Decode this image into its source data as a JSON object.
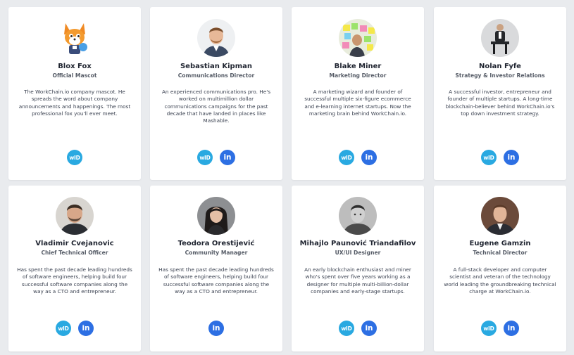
{
  "colors": {
    "page_bg": "#e9ebee",
    "card_bg": "#ffffff",
    "workchain_id": "#29a9e1",
    "linkedin": "#2d6fe3"
  },
  "social_labels": {
    "workchain_id": "wID",
    "linkedin": "in"
  },
  "team": [
    {
      "name": "Blox Fox",
      "role": "Official Mascot",
      "bio": "The WorkChain.io company mascot. He spreads the word about company announcements and happenings. The most professional fox you'll ever meet.",
      "avatar_icon": "fox-mascot-icon",
      "socials": [
        "workchain_id"
      ]
    },
    {
      "name": "Sebastian Kipman",
      "role": "Communications Director",
      "bio": "An experienced communications pro. He's worked on multimillion dollar communications campaigns for the past decade that have landed in places like Mashable.",
      "avatar_icon": "person-photo-icon",
      "socials": [
        "workchain_id",
        "linkedin"
      ]
    },
    {
      "name": "Blake Miner",
      "role": "Marketing Director",
      "bio": "A marketing wizard and founder of successful multiple six-figure ecommerce and e-learning internet startups. Now the marketing brain behind WorkChain.io.",
      "avatar_icon": "sticky-notes-icon",
      "socials": [
        "workchain_id",
        "linkedin"
      ]
    },
    {
      "name": "Nolan Fyfe",
      "role": "Strategy & Investor Relations",
      "bio": "A successful investor, entrepreneur and founder of multiple startups. A long-time blockchain-believer behind WorkChain.io's top down investment strategy.",
      "avatar_icon": "person-seated-icon",
      "socials": [
        "workchain_id",
        "linkedin"
      ]
    },
    {
      "name": "Vladimir Cvejanovic",
      "role": "Chief Technical Officer",
      "bio": "Has spent the past decade leading hundreds of software engineers, helping build four successful software companies along the way as a CTO and entrepreneur.",
      "avatar_icon": "person-photo-icon",
      "socials": [
        "workchain_id",
        "linkedin"
      ]
    },
    {
      "name": "Teodora Orestijević",
      "role": "Community Manager",
      "bio": "Has spent the past decade leading hundreds of software engineers, helping build four successful software companies along the way as a CTO and entrepreneur.",
      "avatar_icon": "person-photo-icon",
      "socials": [
        "linkedin"
      ]
    },
    {
      "name": "Mihajlo Paunović Triandafilov",
      "role": "UX/UI Designer",
      "bio": "An early blockchain enthusiast and miner who's spent over five years working as a designer for multiple multi-billion-dollar companies and early-stage startups.",
      "avatar_icon": "person-photo-icon",
      "socials": [
        "workchain_id",
        "linkedin"
      ]
    },
    {
      "name": "Eugene Gamzin",
      "role": "Technical Director",
      "bio": "A full-stack developer and computer scientist and veteran of the technology world leading the groundbreaking technical charge at WorkChain.io.",
      "avatar_icon": "person-photo-icon",
      "socials": [
        "workchain_id",
        "linkedin"
      ]
    }
  ]
}
